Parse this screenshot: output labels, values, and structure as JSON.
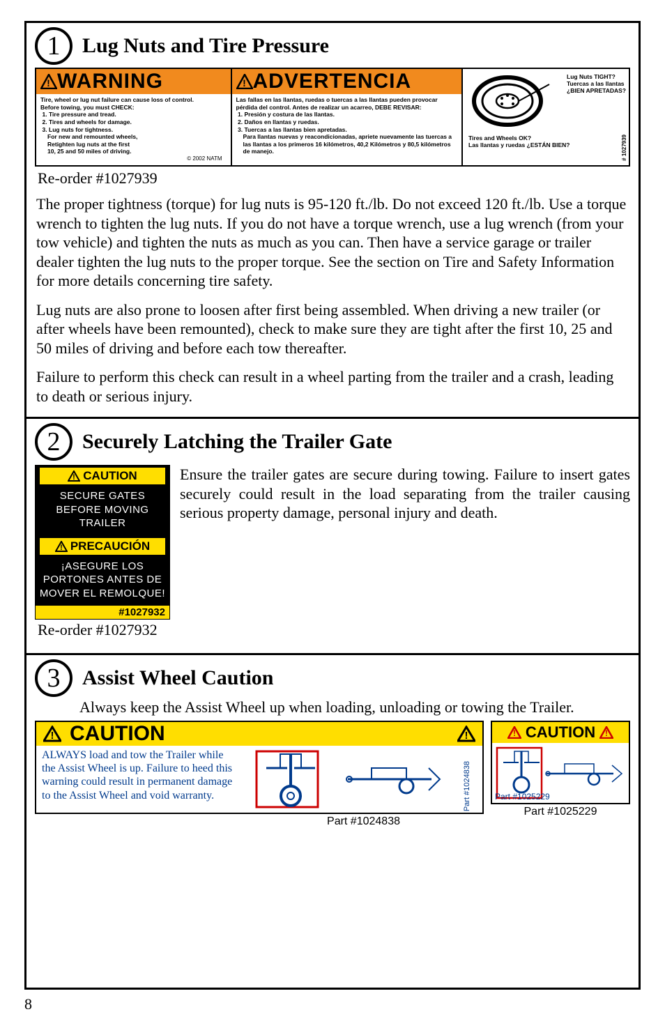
{
  "page_number": "8",
  "section1": {
    "num": "1",
    "title": "Lug Nuts and Tire Pressure",
    "warning_en": {
      "heading": "WARNING",
      "lead": "Tire, wheel or lug nut failure can cause loss of control.",
      "before": "Before towing, you must CHECK:",
      "item1": "Tire pressure and tread.",
      "item2": "Tires and wheels for damage.",
      "item3": "Lug nuts for tightness.",
      "sub1": "For new and remounted wheels,",
      "sub2": "Retighten lug nuts at the first",
      "sub3": "10, 25 and 50 miles of driving.",
      "copyright": "© 2002 NATM"
    },
    "warning_es": {
      "heading": "ADVERTENCIA",
      "lead": "Las fallas en las llantas, ruedas o tuercas a las llantas pueden provocar pérdida del control. Antes de realizar un acarreo, DEBE REVISAR:",
      "item1": "Presión y costura de las llantas.",
      "item2": "Daños en llantas y ruedas.",
      "item3": "Tuercas a las llantas bien apretadas.",
      "sub": "Para llantas nuevas y reacondicionadas, apriete nuevamente las tuercas a las llantas a los primeros 16 kilómetros, 40,2 Kilómetros y 80,5 kilómetros de manejo."
    },
    "diagram": {
      "lug_en": "Lug Nuts TIGHT?",
      "lug_es": "Tuercas a las llantas",
      "lug_es2": "¿BIEN APRETADAS?",
      "tires_en": "Tires and Wheels OK?",
      "tires_es": "Las llantas y ruedas ¿ESTÁN BIEN?",
      "partnum": "# 1027939"
    },
    "reorder": "Re-order #1027939",
    "para1": "The proper tightness (torque) for lug nuts is 95-120 ft./lb.  Do not exceed 120 ft./lb.  Use a torque wrench to tighten the lug nuts.  If you do not have a torque wrench, use a lug wrench (from your tow vehicle) and tighten the nuts as much as you can.  Then have a service garage or trailer dealer tighten the lug nuts to the proper torque.  See the section on Tire and Safety Information for more details concerning tire safety.",
    "para2": "Lug nuts are also prone to loosen after first being assembled.  When driving a new trailer (or after wheels have been remounted), check to make sure they are tight after the first 10, 25 and 50 miles of driving and before each tow thereafter.",
    "para3": "Failure to perform this check can result in a wheel parting from the trailer and a crash, leading to death or serious injury."
  },
  "section2": {
    "num": "2",
    "title": "Securely Latching the Trailer Gate",
    "label": {
      "caution": "CAUTION",
      "text_en": "SECURE GATES BEFORE MOVING TRAILER",
      "precaucion": "PRECAUCIÓN",
      "text_es": "¡ASEGURE LOS PORTONES ANTES DE MOVER EL REMOLQUE!",
      "partnum": "#1027932"
    },
    "reorder": "Re-order #1027932",
    "para": "Ensure the trailer gates are secure during towing.  Failure to insert gates securely could result in the load separating from the trailer causing serious property damage, personal injury and death."
  },
  "section3": {
    "num": "3",
    "title": "Assist Wheel Caution",
    "intro": "Always keep the Assist Wheel up when loading, unloading or towing the Trailer.",
    "label_big": {
      "heading": "CAUTION",
      "text": "ALWAYS load and tow the Trailer while the Assist Wheel is up. Failure to heed this warning could result in permanent damage to the Assist Wheel and void warranty.",
      "partnum": "Part #1024838"
    },
    "caption_big": "Part #1024838",
    "label_small": {
      "heading": "CAUTION",
      "partnum": "Part #1025229"
    },
    "caption_small": "Part #1025229"
  }
}
